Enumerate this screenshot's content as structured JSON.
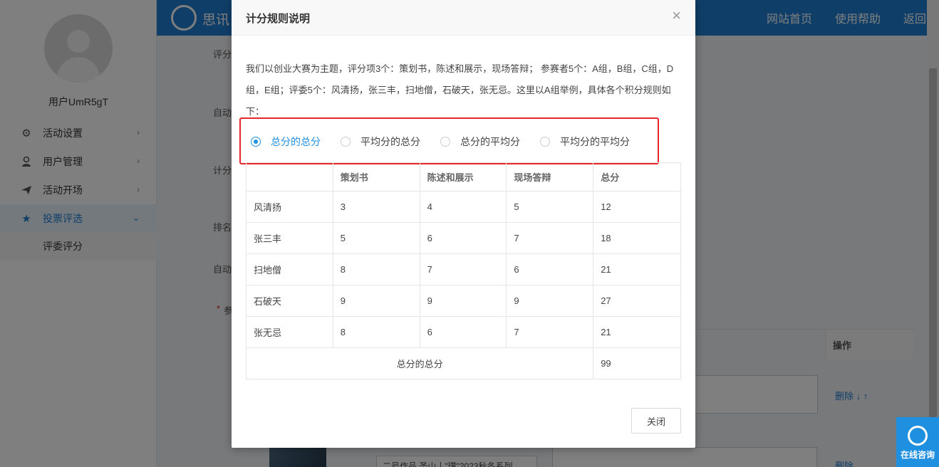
{
  "app": {
    "logo_text": "思讯",
    "top_links": [
      "网站首页",
      "使用帮助",
      "返回"
    ]
  },
  "sidebar": {
    "username": "用户UmR5gT",
    "items": [
      {
        "label": "活动设置",
        "icon": "gear-icon",
        "arrow": "›"
      },
      {
        "label": "用户管理",
        "icon": "user-icon",
        "arrow": "›"
      },
      {
        "label": "活动开场",
        "icon": "paper-plane-icon",
        "arrow": "›"
      },
      {
        "label": "投票评选",
        "icon": "star-icon",
        "arrow": "⌄",
        "active": true
      }
    ],
    "submenu": "评委评分"
  },
  "background": {
    "labels": [
      "评分",
      "自动",
      "计分",
      "排名",
      "自动",
      "参"
    ],
    "required_mark": "*",
    "table_header_action": "操作",
    "actions_row1": "删除 ↓ ↑",
    "actions_row2": "删除",
    "field_text": "二号作品 圣山丨\"璞\"2023秋冬系列"
  },
  "modal": {
    "title": "计分规则说明",
    "close_icon": "×",
    "description": "我们以创业大赛为主题，评分项3个：策划书，陈述和展示，现场答辩； 参赛者5个：A组，B组，C组，D组，E组；评委5个：风清扬，张三丰，扫地僧，石破天，张无忌。这里以A组举例，具体各个积分规则如下：",
    "options": [
      {
        "label": "总分的总分",
        "checked": true
      },
      {
        "label": "平均分的总分",
        "checked": false
      },
      {
        "label": "总分的平均分",
        "checked": false
      },
      {
        "label": "平均分的平均分",
        "checked": false
      }
    ],
    "table": {
      "headers": [
        "",
        "策划书",
        "陈述和展示",
        "现场答辩",
        "总分"
      ],
      "rows": [
        [
          "风清扬",
          "3",
          "4",
          "5",
          "12"
        ],
        [
          "张三丰",
          "5",
          "6",
          "7",
          "18"
        ],
        [
          "扫地僧",
          "8",
          "7",
          "6",
          "21"
        ],
        [
          "石破天",
          "9",
          "9",
          "9",
          "27"
        ],
        [
          "张无忌",
          "8",
          "6",
          "7",
          "21"
        ]
      ],
      "footer_label": "总分的总分",
      "footer_value": "99"
    },
    "close_button": "关闭"
  },
  "chat": {
    "label": "在线咨询"
  },
  "colors": {
    "accent": "#1f7dd1",
    "highlight": "#e5262b",
    "radio": "#1f8fe0"
  }
}
